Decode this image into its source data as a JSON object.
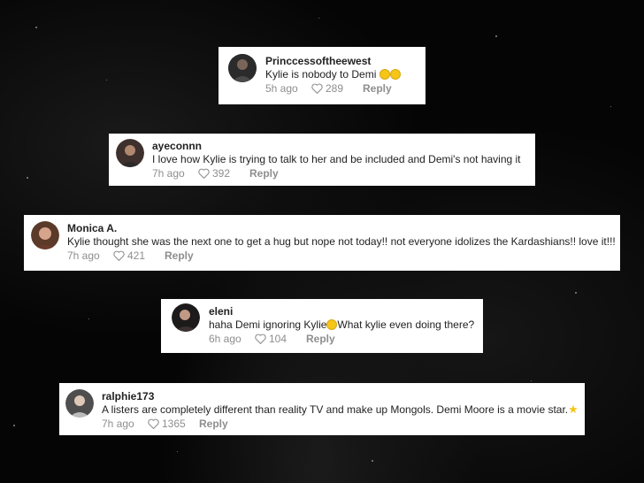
{
  "comments": [
    {
      "username": "Princcessoftheewest",
      "text": "Kylie is nobody to Demi",
      "emoji": "😳😳",
      "time": "5h ago",
      "likes": "289",
      "reply": "Reply",
      "avatar_color": "#3a3a3a"
    },
    {
      "username": "ayeconnn",
      "text": "I love how Kylie is trying to talk to her and be included and Demi's not having it",
      "time": "7h ago",
      "likes": "392",
      "reply": "Reply",
      "avatar_color": "#5a4a44"
    },
    {
      "username": "Monica A.",
      "text": "Kylie thought she was the next one to get a hug but nope not today!! not everyone idolizes the Kardashians!! love it!!!",
      "time": "7h ago",
      "likes": "421",
      "reply": "Reply",
      "avatar_color": "#8a5a40"
    },
    {
      "username": "eleni",
      "text_before": "haha Demi ignoring Kylie",
      "emoji": "😊",
      "text_after": "What kylie even doing there?",
      "time": "6h ago",
      "likes": "104",
      "reply": "Reply",
      "avatar_color": "#2e2a2a"
    },
    {
      "username": "ralphie173",
      "text": "A listers are completely different than reality TV and make up Mongols. Demi Moore is a movie star.",
      "emoji": "⭐",
      "time": "7h ago",
      "likes": "1365",
      "reply": "Reply",
      "avatar_color": "#6a6a6a"
    }
  ],
  "icons": {
    "like": "heart-outline-icon"
  }
}
